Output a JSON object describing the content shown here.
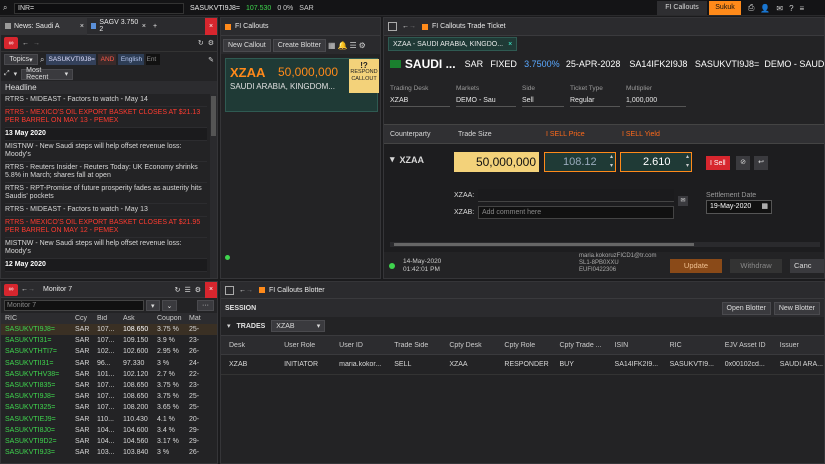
{
  "topbar": {
    "search_value": "INR=",
    "ticker": "SASUKVTI9J8=",
    "price": "107.530",
    "change": "0 0%",
    "ccy": "SAR",
    "tab1": "FI Callouts",
    "tab2": "Sukuk"
  },
  "news": {
    "tab1": "News: Saudi A",
    "tab2": "SAGV 3.750 2",
    "filter_topics": "Topics",
    "filter_value": "SASUKVTI9J8=",
    "filter_and": "AND",
    "filter_lang": "English",
    "filter_entity": "Ent",
    "sort": "Most Recent",
    "headline_header": "Headline",
    "items": [
      {
        "text": "RTRS - MIDEAST - Factors to watch - May 14",
        "style": "flag"
      },
      {
        "text": "RTRS - MEXICO'S OIL EXPORT BASKET CLOSES AT $21.13 PER BARREL ON MAY 13 - PEMEX",
        "style": "red"
      },
      {
        "text": "13 May 2020",
        "style": "date"
      },
      {
        "text": "MISTNW - New Saudi steps will help offset revenue loss: Moody's",
        "style": "flag"
      },
      {
        "text": "RTRS - Reuters Insider - Reuters Today: UK Economy shrinks 5.8% in March; shares fall at open",
        "style": "box"
      },
      {
        "text": "RTRS - RPT-Promise of future prosperity fades as austerity hits Saudis' pockets",
        "style": "flag"
      },
      {
        "text": "RTRS - MIDEAST - Factors to watch - May 13",
        "style": "plain"
      },
      {
        "text": "RTRS - MEXICO'S OIL EXPORT BASKET CLOSES AT $21.95 PER BARREL ON MAY 12 - PEMEX",
        "style": "red"
      },
      {
        "text": "MISTNW - New Saudi steps will help offset revenue loss: Moody's",
        "style": "flag"
      },
      {
        "text": "12 May 2020",
        "style": "date"
      }
    ]
  },
  "monitor": {
    "title": "Monitor 7",
    "input_placeholder": "Monitor 7",
    "headers": [
      "RIC",
      "Ccy",
      "Bid",
      "Ask",
      "Coupon",
      "Mat"
    ],
    "rows": [
      [
        "SASUKVTI9J8=",
        "SAR",
        "107...",
        "108.650",
        "3.75 %",
        "25-"
      ],
      [
        "SASUKVTI31=",
        "SAR",
        "107...",
        "109.150",
        "3.9 %",
        "23-"
      ],
      [
        "SASUKVTHTI7=",
        "SAR",
        "102...",
        "102.600",
        "2.95 %",
        "26-"
      ],
      [
        "SASUKVTII31=",
        "SAR",
        "96...",
        "97.330",
        "3 %",
        "24-"
      ],
      [
        "SASUKVTHV38=",
        "SAR",
        "101...",
        "102.120",
        "2.7 %",
        "22-"
      ],
      [
        "SASUKVTI835=",
        "SAR",
        "107...",
        "108.650",
        "3.75 %",
        "23-"
      ],
      [
        "SASUKVTI9J8=",
        "SAR",
        "107...",
        "108.650",
        "3.75 %",
        "25-"
      ],
      [
        "SASUKVTI325=",
        "SAR",
        "107...",
        "108.200",
        "3.65 %",
        "25-"
      ],
      [
        "SASUKVTIEJ9=",
        "SAR",
        "110...",
        "110.430",
        "4.1 %",
        "20-"
      ],
      [
        "SASUKVTI8J0=",
        "SAR",
        "104...",
        "104.600",
        "3.4 %",
        "29-"
      ],
      [
        "SASUKVTI9D2=",
        "SAR",
        "104...",
        "104.560",
        "3.17 %",
        "29-"
      ],
      [
        "SASUKVTI9J3=",
        "SAR",
        "103...",
        "103.840",
        "3 %",
        "26-"
      ]
    ]
  },
  "callouts": {
    "title": "FI Callouts",
    "new_btn": "New Callout",
    "blotter_btn": "Create Blotter",
    "code": "XZAA",
    "amount": "50,000,000",
    "issuer": "SAUDI ARABIA, KINGDOM...",
    "respond": "RESPOND CALLOUT",
    "respond_icon": "!?"
  },
  "ticket": {
    "title": "FI Callouts Trade Ticket",
    "tab": "XZAA - SAUDI ARABIA, KINGDO...",
    "flag": "SA",
    "issuer": "SAUDI ...",
    "ccy": "SAR",
    "type": "FIXED",
    "coupon": "3.7500%",
    "maturity": "25-APR-2028",
    "isin": "SA14IFK2I9J8",
    "ric": "SASUKVTI9J8=",
    "desk": "DEMO - SAUDI A",
    "fields": [
      {
        "label": "Trading Desk",
        "value": "XZAB"
      },
      {
        "label": "Markets",
        "value": "DEMO - Sau"
      },
      {
        "label": "Side",
        "value": "Sell"
      },
      {
        "label": "Ticket Type",
        "value": "Regular"
      },
      {
        "label": "Multiplier",
        "value": "1,000,000"
      }
    ],
    "col_counterparty": "Counterparty",
    "col_size": "Trade Size",
    "col_price": "I SELL Price",
    "col_yield": "I SELL Yield",
    "counterparty": "XZAA",
    "size": "50,000,000",
    "price": "108.12",
    "yield": "2.610",
    "sell_btn": "I Sell",
    "cp_label": "XZAA:",
    "cp_value": "",
    "comment_label": "XZAB:",
    "comment_placeholder": "Add comment here",
    "settle_label": "Settlement Date",
    "settle_value": "19-May-2020",
    "footer_date": "14-May-2020",
    "footer_time": "01:42:01 PM",
    "footer_user": "maria.kokoruzFICD1@tr.com",
    "footer_id1": "SL1-8PB0XXU",
    "footer_id2": "EUFI0422306",
    "update_btn": "Update",
    "withdraw_btn": "Withdraw",
    "cancel_btn": "Canc"
  },
  "blotter": {
    "title": "FI Callouts Blotter",
    "session": "SESSION",
    "open_btn": "Open Blotter",
    "new_btn": "New Blotter",
    "trades": "TRADES",
    "desk_sel": "XZAB",
    "headers": [
      "Desk",
      "User Role",
      "User ID",
      "Trade Side",
      "Cpty Desk",
      "Cpty Role",
      "Cpty Trade ...",
      "ISIN",
      "RIC",
      "EJV Asset ID",
      "Issuer"
    ],
    "row": [
      "XZAB",
      "INITIATOR",
      "maria.kokor...",
      "SELL",
      "XZAA",
      "RESPONDER",
      "BUY",
      "SA14IFK2I9...",
      "SASUKVTI9...",
      "0x00102cd...",
      "SAUDI ARA..."
    ]
  },
  "colors": {
    "accent": "#ff8a1a",
    "green": "#3fd44e",
    "red": "#d7262e",
    "yellow": "#f3d27a",
    "teal": "#1f3a36"
  }
}
